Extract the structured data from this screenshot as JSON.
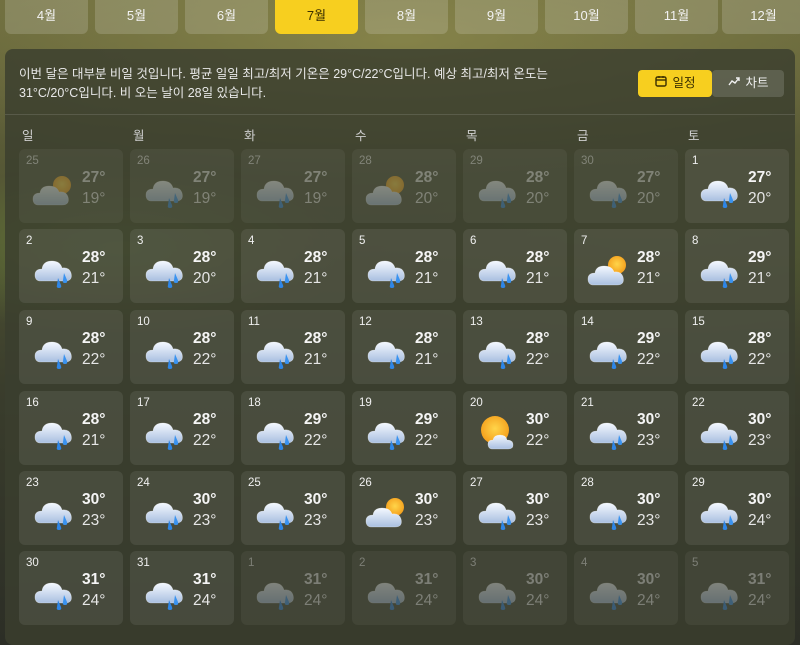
{
  "months": [
    "4월",
    "5월",
    "6월",
    "7월",
    "8월",
    "9월",
    "10월",
    "11월",
    "12월"
  ],
  "active_month_index": 3,
  "summary": "이번 달은 대부분 비일 것입니다. 평균 일일 최고/최저 기온은 29°C/22°C입니다. 예상 최고/최저 온도는 31°C/20°C입니다. 비 오는 날이 28일 있습니다.",
  "view_toggle": {
    "calendar_label": "일정",
    "chart_label": "차트",
    "calendar_icon": "calendar-icon",
    "chart_icon": "chart-line-icon",
    "selected": "calendar"
  },
  "weekdays": [
    "일",
    "월",
    "화",
    "수",
    "목",
    "금",
    "토"
  ],
  "colors": {
    "accent": "#f7cf1f"
  },
  "days": [
    {
      "day": "25",
      "hi": "27°",
      "lo": "19°",
      "icon": "partly-cloudy",
      "dim": true
    },
    {
      "day": "26",
      "hi": "27°",
      "lo": "19°",
      "icon": "rain",
      "dim": true
    },
    {
      "day": "27",
      "hi": "27°",
      "lo": "19°",
      "icon": "rain",
      "dim": true
    },
    {
      "day": "28",
      "hi": "28°",
      "lo": "20°",
      "icon": "partly-cloudy",
      "dim": true
    },
    {
      "day": "29",
      "hi": "28°",
      "lo": "20°",
      "icon": "rain",
      "dim": true
    },
    {
      "day": "30",
      "hi": "27°",
      "lo": "20°",
      "icon": "rain",
      "dim": true
    },
    {
      "day": "1",
      "hi": "27°",
      "lo": "20°",
      "icon": "rain",
      "dim": false
    },
    {
      "day": "2",
      "hi": "28°",
      "lo": "21°",
      "icon": "rain",
      "dim": false
    },
    {
      "day": "3",
      "hi": "28°",
      "lo": "20°",
      "icon": "rain",
      "dim": false
    },
    {
      "day": "4",
      "hi": "28°",
      "lo": "21°",
      "icon": "rain",
      "dim": false
    },
    {
      "day": "5",
      "hi": "28°",
      "lo": "21°",
      "icon": "rain",
      "dim": false
    },
    {
      "day": "6",
      "hi": "28°",
      "lo": "21°",
      "icon": "rain",
      "dim": false
    },
    {
      "day": "7",
      "hi": "28°",
      "lo": "21°",
      "icon": "partly-cloudy",
      "dim": false
    },
    {
      "day": "8",
      "hi": "29°",
      "lo": "21°",
      "icon": "rain",
      "dim": false
    },
    {
      "day": "9",
      "hi": "28°",
      "lo": "22°",
      "icon": "rain",
      "dim": false
    },
    {
      "day": "10",
      "hi": "28°",
      "lo": "22°",
      "icon": "rain",
      "dim": false
    },
    {
      "day": "11",
      "hi": "28°",
      "lo": "21°",
      "icon": "rain",
      "dim": false
    },
    {
      "day": "12",
      "hi": "28°",
      "lo": "21°",
      "icon": "rain",
      "dim": false
    },
    {
      "day": "13",
      "hi": "28°",
      "lo": "22°",
      "icon": "rain",
      "dim": false
    },
    {
      "day": "14",
      "hi": "29°",
      "lo": "22°",
      "icon": "rain",
      "dim": false
    },
    {
      "day": "15",
      "hi": "28°",
      "lo": "22°",
      "icon": "rain",
      "dim": false
    },
    {
      "day": "16",
      "hi": "28°",
      "lo": "21°",
      "icon": "rain",
      "dim": false
    },
    {
      "day": "17",
      "hi": "28°",
      "lo": "22°",
      "icon": "rain",
      "dim": false
    },
    {
      "day": "18",
      "hi": "29°",
      "lo": "22°",
      "icon": "rain",
      "dim": false
    },
    {
      "day": "19",
      "hi": "29°",
      "lo": "22°",
      "icon": "rain",
      "dim": false
    },
    {
      "day": "20",
      "hi": "30°",
      "lo": "22°",
      "icon": "mostly-sunny",
      "dim": false
    },
    {
      "day": "21",
      "hi": "30°",
      "lo": "23°",
      "icon": "rain",
      "dim": false
    },
    {
      "day": "22",
      "hi": "30°",
      "lo": "23°",
      "icon": "rain",
      "dim": false
    },
    {
      "day": "23",
      "hi": "30°",
      "lo": "23°",
      "icon": "rain",
      "dim": false
    },
    {
      "day": "24",
      "hi": "30°",
      "lo": "23°",
      "icon": "rain",
      "dim": false
    },
    {
      "day": "25",
      "hi": "30°",
      "lo": "23°",
      "icon": "rain",
      "dim": false
    },
    {
      "day": "26",
      "hi": "30°",
      "lo": "23°",
      "icon": "partly-cloudy",
      "dim": false
    },
    {
      "day": "27",
      "hi": "30°",
      "lo": "23°",
      "icon": "rain",
      "dim": false
    },
    {
      "day": "28",
      "hi": "30°",
      "lo": "23°",
      "icon": "rain",
      "dim": false
    },
    {
      "day": "29",
      "hi": "30°",
      "lo": "24°",
      "icon": "rain",
      "dim": false
    },
    {
      "day": "30",
      "hi": "31°",
      "lo": "24°",
      "icon": "rain",
      "dim": false
    },
    {
      "day": "31",
      "hi": "31°",
      "lo": "24°",
      "icon": "rain",
      "dim": false
    },
    {
      "day": "1",
      "hi": "31°",
      "lo": "24°",
      "icon": "rain",
      "dim": true
    },
    {
      "day": "2",
      "hi": "31°",
      "lo": "24°",
      "icon": "rain",
      "dim": true
    },
    {
      "day": "3",
      "hi": "30°",
      "lo": "24°",
      "icon": "rain",
      "dim": true
    },
    {
      "day": "4",
      "hi": "30°",
      "lo": "24°",
      "icon": "rain",
      "dim": true
    },
    {
      "day": "5",
      "hi": "31°",
      "lo": "24°",
      "icon": "rain",
      "dim": true
    }
  ]
}
